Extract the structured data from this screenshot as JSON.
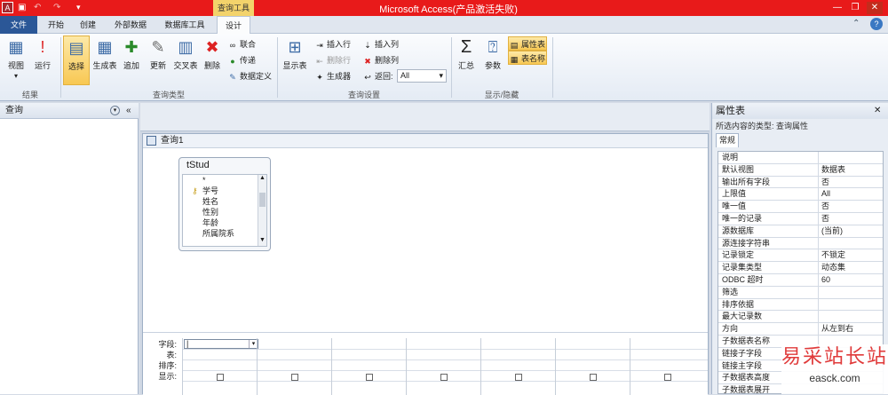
{
  "title_bar": {
    "context_tab": "查询工具",
    "app_title": "Microsoft Access(产品激活失败)",
    "window_buttons": [
      "minimize-icon",
      "restore-icon",
      "close-icon"
    ]
  },
  "tabs": [
    "文件",
    "开始",
    "创建",
    "外部数据",
    "数据库工具",
    "设计"
  ],
  "ribbon": {
    "results": {
      "label": "结果",
      "view": "视图",
      "run": "运行"
    },
    "query_type": {
      "label": "查询类型",
      "select": "选择",
      "make_table": "生成表",
      "append": "追加",
      "update": "更新",
      "crosstab": "交叉表",
      "delete": "删除",
      "union": "联合",
      "pass_through": "传递",
      "data_definition": "数据定义"
    },
    "query_setup": {
      "label": "查询设置",
      "show_table": "显示表",
      "insert_rows": "插入行",
      "delete_rows": "删除行",
      "builder": "生成器",
      "insert_columns": "插入列",
      "delete_columns": "删除列",
      "return_label": "返回:",
      "return_value": "All"
    },
    "show_hide": {
      "label": "显示/隐藏",
      "totals": "汇总",
      "parameters": "参数",
      "property_sheet": "属性表",
      "table_names": "表名称"
    }
  },
  "nav": {
    "title": "查询"
  },
  "query_window": {
    "title": "查询1",
    "table": {
      "name": "tStud",
      "fields": [
        "*",
        "学号",
        "姓名",
        "性别",
        "年龄",
        "所属院系"
      ],
      "key_field": "学号"
    },
    "grid_rows": [
      "字段:",
      "表:",
      "排序:",
      "显示:"
    ]
  },
  "property_sheet": {
    "title": "属性表",
    "selection_type": "所选内容的类型: 查询属性",
    "tab": "常规",
    "rows": [
      {
        "name": "说明",
        "value": ""
      },
      {
        "name": "默认视图",
        "value": "数据表"
      },
      {
        "name": "输出所有字段",
        "value": "否"
      },
      {
        "name": "上限值",
        "value": "All"
      },
      {
        "name": "唯一值",
        "value": "否"
      },
      {
        "name": "唯一的记录",
        "value": "否"
      },
      {
        "name": "源数据库",
        "value": "(当前)"
      },
      {
        "name": "源连接字符串",
        "value": ""
      },
      {
        "name": "记录锁定",
        "value": "不锁定"
      },
      {
        "name": "记录集类型",
        "value": "动态集"
      },
      {
        "name": "ODBC 超时",
        "value": "60"
      },
      {
        "name": "筛选",
        "value": ""
      },
      {
        "name": "排序依据",
        "value": ""
      },
      {
        "name": "最大记录数",
        "value": ""
      },
      {
        "name": "方向",
        "value": "从左到右"
      },
      {
        "name": "子数据表名称",
        "value": ""
      },
      {
        "name": "链接子字段",
        "value": ""
      },
      {
        "name": "链接主字段",
        "value": ""
      },
      {
        "name": "子数据表高度",
        "value": ""
      },
      {
        "name": "子数据表展开",
        "value": ""
      }
    ]
  },
  "watermark": {
    "cn": "易采站长站",
    "en": "easck.com"
  }
}
